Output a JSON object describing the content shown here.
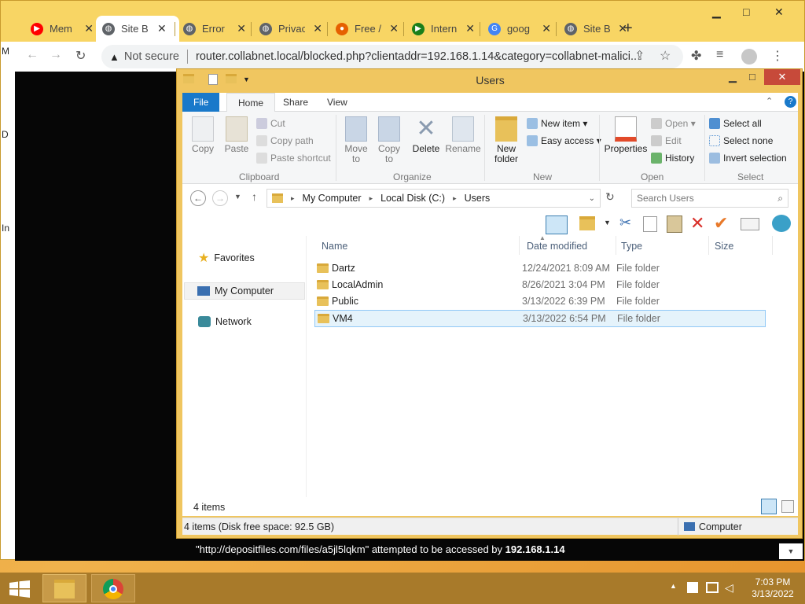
{
  "browser": {
    "tabs": [
      {
        "title": "Mem",
        "icon": "youtube-icon",
        "color": "#ff0000"
      },
      {
        "title": "Site B",
        "icon": "globe-icon",
        "color": "#5f6368"
      },
      {
        "title": "Error",
        "icon": "globe-icon",
        "color": "#5f6368"
      },
      {
        "title": "Privac",
        "icon": "globe-icon",
        "color": "#5f6368"
      },
      {
        "title": "Free /",
        "icon": "firefox-icon",
        "color": "#e66000"
      },
      {
        "title": "Intern",
        "icon": "play-icon",
        "color": "#1a7f1a"
      },
      {
        "title": "goog",
        "icon": "google-icon",
        "color": "#4285f4"
      },
      {
        "title": "Site B",
        "icon": "globe-icon",
        "color": "#5f6368"
      }
    ],
    "not_secure": "Not secure",
    "url": "router.collabnet.local/blocked.php?clientaddr=192.168.1.14&category=collabnet-malici...",
    "blocked_message_pre": "\"http://depositfiles.com/files/a5jl5lqkm\" attempted to be accessed by ",
    "blocked_ip": "192.168.1.14",
    "edge_letters": [
      "M",
      "D",
      "In"
    ]
  },
  "explorer": {
    "title": "Users",
    "ribbon_tabs": [
      "File",
      "Home",
      "Share",
      "View"
    ],
    "clipboard": {
      "copy": "Copy",
      "paste": "Paste",
      "cut": "Cut",
      "copy_path": "Copy path",
      "paste_shortcut": "Paste shortcut",
      "label": "Clipboard"
    },
    "organize": {
      "move_to": "Move to",
      "copy_to": "Copy to",
      "delete": "Delete",
      "rename": "Rename",
      "label": "Organize"
    },
    "new": {
      "new_folder": "New folder",
      "new_item": "New item",
      "easy_access": "Easy access",
      "label": "New"
    },
    "open": {
      "properties": "Properties",
      "open": "Open",
      "edit": "Edit",
      "history": "History",
      "label": "Open"
    },
    "select": {
      "select_all": "Select all",
      "select_none": "Select none",
      "invert": "Invert selection",
      "label": "Select"
    },
    "breadcrumb": [
      "My Computer",
      "Local Disk (C:)",
      "Users"
    ],
    "search_placeholder": "Search Users",
    "nav": {
      "favorites": "Favorites",
      "my_computer": "My Computer",
      "network": "Network"
    },
    "columns": {
      "name": "Name",
      "date": "Date modified",
      "type": "Type",
      "size": "Size"
    },
    "files": [
      {
        "name": "Dartz",
        "date": "12/24/2021 8:09 AM",
        "type": "File folder"
      },
      {
        "name": "LocalAdmin",
        "date": "8/26/2021 3:04 PM",
        "type": "File folder"
      },
      {
        "name": "Public",
        "date": "3/13/2022 6:39 PM",
        "type": "File folder"
      },
      {
        "name": "VM4",
        "date": "3/13/2022 6:54 PM",
        "type": "File folder"
      }
    ],
    "item_count": "4 items",
    "status": "4 items (Disk free space: 92.5 GB)",
    "status_right": "Computer"
  },
  "taskbar": {
    "time": "7:03 PM",
    "date": "3/13/2022"
  }
}
